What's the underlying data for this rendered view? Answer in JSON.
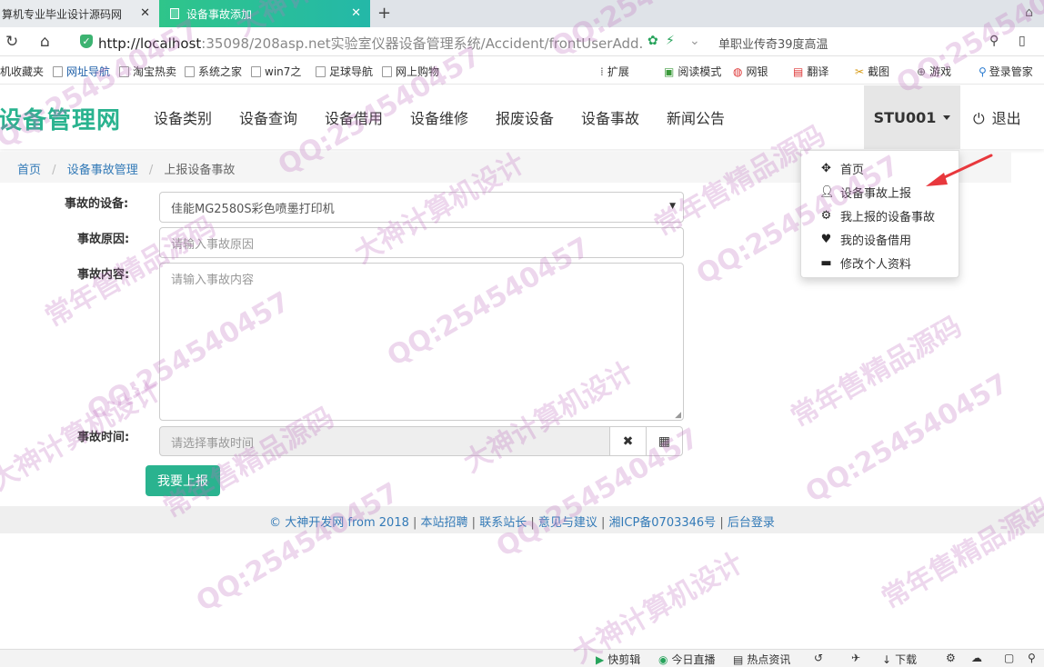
{
  "browser": {
    "tabs": [
      {
        "label": "算机专业毕业设计源码网"
      },
      {
        "label": "设备事故添加"
      }
    ],
    "url_host": "http://localhost",
    "url_path": ":35098/208asp.net实验室仪器设备管理系统/Accident/frontUserAdd.a",
    "search_text": "单职业传奇39度高温",
    "bookmarks": [
      "机收藏夹",
      "网址导航",
      "淘宝热卖",
      "系统之家",
      "win7之",
      "足球导航",
      "网上购物"
    ],
    "toolbar": [
      "扩展",
      "阅读模式",
      "网银",
      "翻译",
      "截图",
      "游戏",
      "登录管家"
    ]
  },
  "site": {
    "brand": "设备管理网",
    "nav": [
      "设备类别",
      "设备查询",
      "设备借用",
      "设备维修",
      "报废设备",
      "设备事故",
      "新闻公告"
    ],
    "user": "STU001",
    "logout": "退出"
  },
  "breadcrumb": {
    "home": "首页",
    "section": "设备事故管理",
    "current": "上报设备事故"
  },
  "form": {
    "device_label": "事故的设备:",
    "device_value": "佳能MG2580S彩色喷墨打印机",
    "reason_label": "事故原因:",
    "reason_placeholder": "请输入事故原因",
    "content_label": "事故内容:",
    "content_placeholder": "请输入事故内容",
    "time_label": "事故时间:",
    "time_placeholder": "请选择事故时间",
    "submit": "我要上报"
  },
  "dropdown": {
    "items": [
      {
        "label": "首页",
        "icon": "move-icon"
      },
      {
        "label": "设备事故上报",
        "icon": "user-icon"
      },
      {
        "label": "我上报的设备事故",
        "icon": "gear-icon"
      },
      {
        "label": "我的设备借用",
        "icon": "heart-icon"
      },
      {
        "label": "修改个人资料",
        "icon": "card-icon"
      }
    ]
  },
  "footer": {
    "copyright": "© 大神开发网 from 2018",
    "links": [
      "本站招聘",
      "联系站长",
      "意见与建议",
      "湘ICP备0703346号",
      "后台登录"
    ]
  },
  "statusbar": [
    "快剪辑",
    "今日直播",
    "热点资讯",
    "下载"
  ],
  "watermarks": [
    "QQ:254540457",
    "常年售精品源码",
    "大神计算机设计"
  ],
  "colors": {
    "accent": "#2ab38f",
    "link": "#337ab7",
    "arrow": "#e8383d"
  }
}
